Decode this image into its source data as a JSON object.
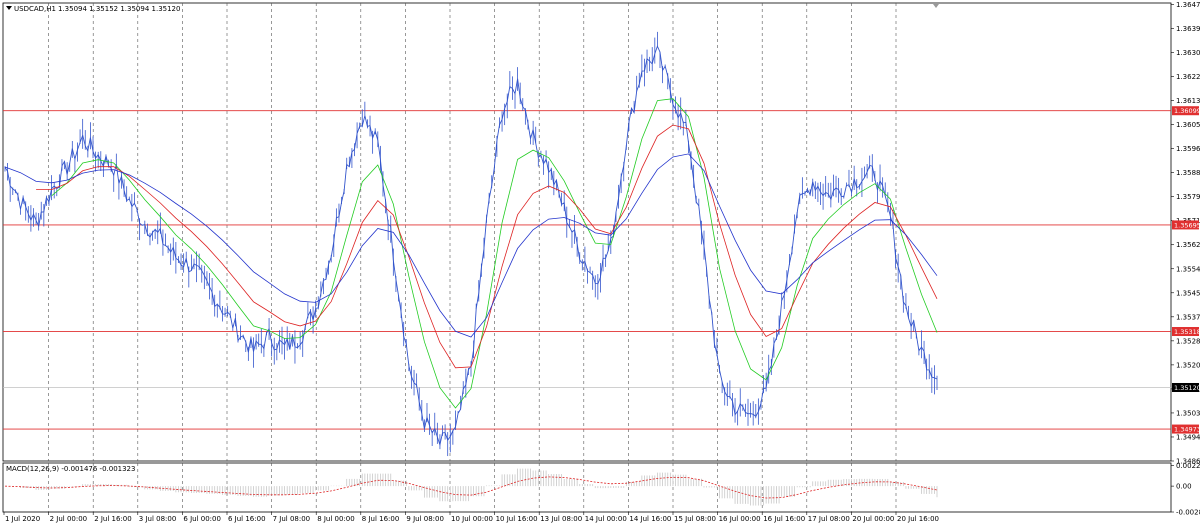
{
  "header": {
    "symbol": "USDCAD,H1",
    "ohlc": "1.35094 1.35152 1.35094 1.35120"
  },
  "chart_data": [
    {
      "type": "line",
      "series_label": "USDCAD,H1",
      "ylim": [
        1.3486,
        1.3648
      ],
      "y_ticks": [
        "1.36475",
        "1.36390",
        "1.36305",
        "1.36220",
        "1.36135",
        "1.36050",
        "1.35965",
        "1.35880",
        "1.35795",
        "1.35710",
        "1.35625",
        "1.35540",
        "1.35455",
        "1.35370",
        "1.35285",
        "1.35200",
        "1.35115",
        "1.35030",
        "1.34945",
        "1.34860"
      ],
      "x_ticks": [
        "1 Jul 2020",
        "2 Jul 00:00",
        "2 Jul 16:00",
        "3 Jul 08:00",
        "6 Jul 00:00",
        "6 Jul 16:00",
        "7 Jul 08:00",
        "8 Jul 00:00",
        "8 Jul 16:00",
        "9 Jul 08:00",
        "10 Jul 00:00",
        "10 Jul 16:00",
        "13 Jul 08:00",
        "14 Jul 00:00",
        "14 Jul 16:00",
        "15 Jul 08:00",
        "16 Jul 00:00",
        "16 Jul 16:00",
        "17 Jul 08:00",
        "20 Jul 00:00",
        "20 Jul 16:00"
      ],
      "price_line": [
        1.359,
        1.3578,
        1.357,
        1.3582,
        1.359,
        1.36,
        1.3594,
        1.359,
        1.3578,
        1.357,
        1.3565,
        1.3558,
        1.3555,
        1.3548,
        1.354,
        1.3532,
        1.3525,
        1.353,
        1.3526,
        1.353,
        1.354,
        1.356,
        1.359,
        1.3608,
        1.3598,
        1.356,
        1.352,
        1.35,
        1.3492,
        1.3496,
        1.352,
        1.357,
        1.361,
        1.362,
        1.36,
        1.359,
        1.3575,
        1.356,
        1.355,
        1.3562,
        1.36,
        1.3625,
        1.363,
        1.3615,
        1.36,
        1.356,
        1.3515,
        1.3505,
        1.3502,
        1.351,
        1.354,
        1.3575,
        1.3585,
        1.358,
        1.3583,
        1.3586,
        1.3588,
        1.3572,
        1.354,
        1.3525,
        1.3515
      ],
      "horizontal_levels": [
        {
          "value": 1.36099,
          "label": "1.36099",
          "color": "#e03030"
        },
        {
          "value": 1.35695,
          "label": "1.35695",
          "color": "#e03030"
        },
        {
          "value": 1.35318,
          "label": "1.35318",
          "color": "#e03030"
        },
        {
          "value": 1.34973,
          "label": "1.34973",
          "color": "#e03030"
        }
      ],
      "current_price": {
        "value": 1.3512,
        "label": "1.35120"
      },
      "colors": {
        "price": "#3355cc",
        "ma_fast": "#22cc22",
        "ma_mid": "#dd2222",
        "ma_slow": "#2233cc"
      }
    },
    {
      "type": "line",
      "title": "MACD(12,26,9) -0.001476 -0.001323",
      "ylim": [
        -0.0028,
        0.0025
      ],
      "y_ticks": [
        "0.002247",
        "0.00",
        "-0.002801"
      ],
      "colors": {
        "histogram": "#c8c8c8",
        "signal": "#dd2222"
      }
    }
  ]
}
